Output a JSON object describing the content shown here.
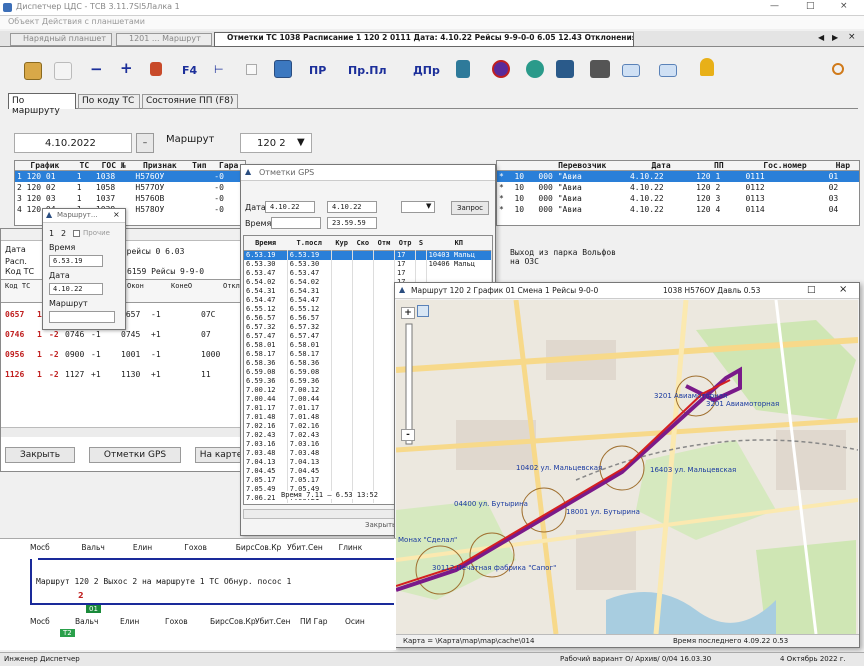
{
  "app": {
    "title": "Диспетчер ЦДС - ТСВ 3.11.7Sl5Лалка 1",
    "menu": "Объект   Действия с планшетами",
    "window_controls": [
      "—",
      "□",
      "×"
    ]
  },
  "doc_tabs": [
    "Нарядный планшет",
    "1201 ...  Маршрут",
    "Отметки ТС 1038 Расписание 1 120 2    0111 Дата: 4.10.22 Рейсы 9-9-0-0  6.05 12.43 Отклонения"
  ],
  "toolbar": {
    "f4_label": "F4",
    "pr_label": "ПР",
    "prpl_label": "Пр.Пл",
    "dpr_label": "ДПр"
  },
  "subtabs": [
    "По маршруту",
    "По коду ТС",
    "Состояние ПП (F8)"
  ],
  "filter": {
    "date_value": "4.10.2022",
    "route_label": "Маршрут",
    "route_value": "120 2"
  },
  "main_grid": {
    "headers": [
      "График",
      "ТС",
      "ГОС №",
      "Признак",
      "Тип",
      "Гара"
    ],
    "rows": [
      [
        "1  120   01",
        "1",
        "1038",
        "Н576ОУ",
        "",
        "-0"
      ],
      [
        "2  120   02",
        "1",
        "1058",
        "Н577ОУ",
        "",
        "-0"
      ],
      [
        "3  120   03",
        "1",
        "1037",
        "Н576ОВ",
        "",
        "-0"
      ],
      [
        "4  120   04",
        "1",
        "1039",
        "Н578ОУ",
        "",
        "-0"
      ]
    ]
  },
  "right_grid": {
    "headers": [
      "",
      "",
      "Перевозчик",
      "Дата",
      "ПП",
      "Гос.номер",
      "Нар"
    ],
    "rows": [
      [
        "*",
        "10",
        "000 \"Авиа",
        "4.10.22",
        "120 1",
        "0111",
        "01"
      ],
      [
        "*",
        "10",
        "000 \"Авиа",
        "4.10.22",
        "120 2",
        "0112",
        "02"
      ],
      [
        "*",
        "10",
        "000 \"Авиа",
        "4.10.22",
        "120 3",
        "0113",
        "03"
      ],
      [
        "*",
        "10",
        "000 \"Авиа",
        "4.10.22",
        "120 4",
        "0114",
        "04"
      ]
    ]
  },
  "stops_panel": {
    "labels": [
      "Дата",
      "Расп.",
      "Код ТС"
    ],
    "line2": "7  рейсы  0    6.03",
    "line3": "6159   Рейсы    9-9-0",
    "col_headers": [
      "Код ТС",
      "Окон",
      "КонеО",
      "Откл"
    ],
    "rows": [
      [
        "0657",
        "1",
        "-2",
        "0657",
        "+1",
        "0657",
        "-1",
        "07С"
      ],
      [
        "0746",
        "1",
        "-2",
        "0746",
        "-1",
        "0745",
        "+1",
        "07"
      ],
      [
        "0956",
        "1",
        "-2",
        "0900",
        "-1",
        "1001",
        "-1",
        "1000"
      ],
      [
        "1126",
        "1",
        "-2",
        "1127",
        "+1",
        "1130",
        "+1",
        "11"
      ]
    ],
    "note": "Выход из парка Вольфов\nна ОЗС",
    "buttons": [
      "Закрыть",
      "Отметки GPS",
      "На карте"
    ]
  },
  "mini_dialog": {
    "title": "Маршрут...",
    "tabs": [
      "1",
      "2"
    ],
    "checkbox": "Прочие",
    "time_label": "Время",
    "time_value": "6.53.19",
    "date_label": "Дата",
    "date_value": "4.10.22",
    "route_label": "Маршрут"
  },
  "gps_window": {
    "title": "Отметки GPS",
    "date_label": "Дата",
    "date_from": "4.10.22",
    "date_to": "4.10.22",
    "time_label": "Время",
    "time_from": "",
    "time_to": "23.59.59",
    "refresh_button": "Запрос",
    "headers": [
      "Время",
      "Т.посл",
      "Кур",
      "Ско",
      "Отм",
      "Отр",
      "S",
      "КП"
    ],
    "rows": [
      [
        "6.53.19",
        "6.53.19",
        "",
        "",
        "",
        "17",
        "",
        "10403 Мальц"
      ],
      [
        "6.53.30",
        "6.53.30",
        "",
        "",
        "",
        "17",
        "",
        "10406 Мальц"
      ],
      [
        "6.53.47",
        "6.53.47",
        "",
        "",
        "",
        "17",
        "",
        ""
      ],
      [
        "6.54.02",
        "6.54.02",
        "",
        "",
        "",
        "17",
        "",
        ""
      ],
      [
        "6.54.31",
        "6.54.31",
        "",
        "",
        "",
        "17",
        "",
        ""
      ],
      [
        "6.54.47",
        "6.54.47",
        "",
        "",
        "",
        "17",
        "",
        ""
      ],
      [
        "6.55.12",
        "6.55.12",
        "",
        "",
        "",
        "17",
        "",
        ""
      ],
      [
        "6.56.57",
        "6.56.57",
        "",
        "",
        "",
        "17",
        "",
        ""
      ],
      [
        "6.57.32",
        "6.57.32",
        "",
        "",
        "",
        "17",
        "",
        ""
      ],
      [
        "6.57.47",
        "6.57.47",
        "",
        "",
        "",
        "17",
        "",
        ""
      ],
      [
        "6.58.01",
        "6.58.01",
        "",
        "",
        "",
        "17",
        "",
        ""
      ],
      [
        "6.58.17",
        "6.58.17",
        "",
        "",
        "",
        "17",
        "",
        ""
      ],
      [
        "6.58.36",
        "6.58.36",
        "",
        "",
        "",
        "17",
        "",
        ""
      ],
      [
        "6.59.08",
        "6.59.08",
        "",
        "",
        "",
        "17",
        "",
        ""
      ],
      [
        "6.59.36",
        "6.59.36",
        "",
        "",
        "",
        "17",
        "",
        ""
      ],
      [
        "7.00.12",
        "7.00.12",
        "",
        "",
        "",
        "17",
        "",
        ""
      ],
      [
        "7.00.44",
        "7.00.44",
        "",
        "",
        "",
        "17",
        "",
        ""
      ],
      [
        "7.01.17",
        "7.01.17",
        "",
        "",
        "",
        "17",
        "",
        ""
      ],
      [
        "7.01.48",
        "7.01.48",
        "",
        "",
        "",
        "17",
        "",
        ""
      ],
      [
        "7.02.16",
        "7.02.16",
        "",
        "",
        "",
        "17",
        "",
        ""
      ],
      [
        "7.02.43",
        "7.02.43",
        "",
        "",
        "",
        "17",
        "",
        ""
      ],
      [
        "7.03.16",
        "7.03.16",
        "",
        "",
        "",
        "17",
        "",
        ""
      ],
      [
        "7.03.48",
        "7.03.48",
        "",
        "",
        "",
        "17",
        "",
        ""
      ],
      [
        "7.04.13",
        "7.04.13",
        "",
        "",
        "",
        "17",
        "",
        ""
      ],
      [
        "7.04.45",
        "7.04.45",
        "",
        "",
        "",
        "17",
        "",
        ""
      ],
      [
        "7.05.17",
        "7.05.17",
        "",
        "",
        "",
        "17",
        "",
        ""
      ],
      [
        "7.05.49",
        "7.05.49",
        "",
        "",
        "",
        "17",
        "",
        ""
      ],
      [
        "7.06.21",
        "7.06.21",
        "",
        "",
        "",
        "17",
        "",
        ""
      ]
    ],
    "footer": "Время 7.11 — 6.53 13:52",
    "hide_button": "Закрыть"
  },
  "map_window": {
    "title": "Маршрут 120 2 График 01 Смена 1 Рейсы 9-0-0",
    "title_right": "1038 Н576ОУ Давль 0.53",
    "zoom_in": "+",
    "zoom_out": "-",
    "status_left": "Карта = \\Карта\\map\\map\\cache\\014",
    "status_right": "Время последнего 4.09.22 0.53",
    "stop_labels": [
      "3201 Авиамоторная",
      "3201 Авиамоторная",
      "10402 ул. Мальцевская",
      "16403 ул. Мальцевская",
      "04400 ул. Бутырина",
      "18001 ул. Бутырина",
      "Монах \"Сделал\"",
      "30112 Печатная фабрика \"Сапог\""
    ],
    "colors": {
      "route_line": "#7a1a8a",
      "track_line": "#d42020",
      "road": "#f7d98a",
      "water": "#a8cde0",
      "park": "#cfe6b4"
    }
  },
  "schematic": {
    "top_stops": [
      "Мосб",
      "Вальч",
      "Елин",
      "Гохов",
      "БирсСов.Кр",
      "Убит.Сен",
      "Глинк"
    ],
    "line_text": "Маршрут  120 2     Выхос  2  на  маршруте  1  ТС  Обнур.  посос  1",
    "bottom_stops": [
      "Мосб",
      "Вальч",
      "Елин",
      "Гохов",
      "БирсСов.Кр",
      "Убит.Сен",
      "ПИ Гар",
      "Осин"
    ],
    "badge_top": "01",
    "badge_bottom": "T2",
    "marker": "2"
  },
  "statusbar": {
    "left": "Инженер Диспетчер",
    "center": "Рабочий вариант О/ Архив/ 0/04",
    "time": "16.03.30",
    "date": "4 Октябрь 2022 г."
  }
}
